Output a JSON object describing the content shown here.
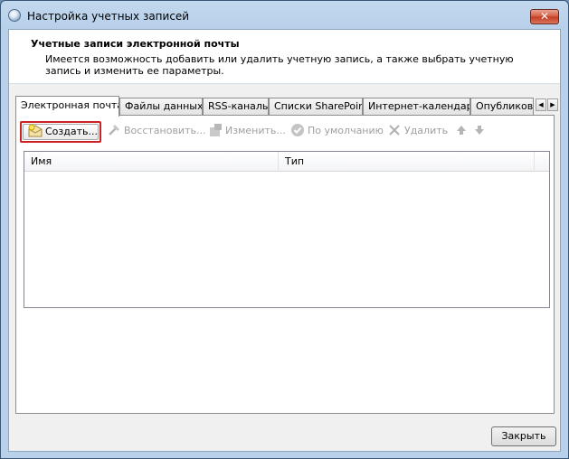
{
  "window": {
    "title": "Настройка учетных записей"
  },
  "header": {
    "title": "Учетные записи электронной почты",
    "description": "Имеется возможность добавить или удалить учетную запись, а также выбрать учетную запись и изменить ее параметры."
  },
  "tabs": [
    {
      "label": "Электронная почта",
      "active": true
    },
    {
      "label": "Файлы данных"
    },
    {
      "label": "RSS-каналы"
    },
    {
      "label": "Списки SharePoint"
    },
    {
      "label": "Интернет-календари"
    },
    {
      "label": "Опубликова"
    }
  ],
  "toolbar": {
    "create": "Создать...",
    "restore": "Восстановить...",
    "edit": "Изменить...",
    "default": "По умолчанию",
    "delete": "Удалить"
  },
  "list": {
    "columns": [
      "Имя",
      "Тип"
    ]
  },
  "footer": {
    "close_label": "Закрыть"
  },
  "colors": {
    "highlight": "#cc2222",
    "titlebar": "#b8d0ea",
    "close": "#c23b22"
  }
}
